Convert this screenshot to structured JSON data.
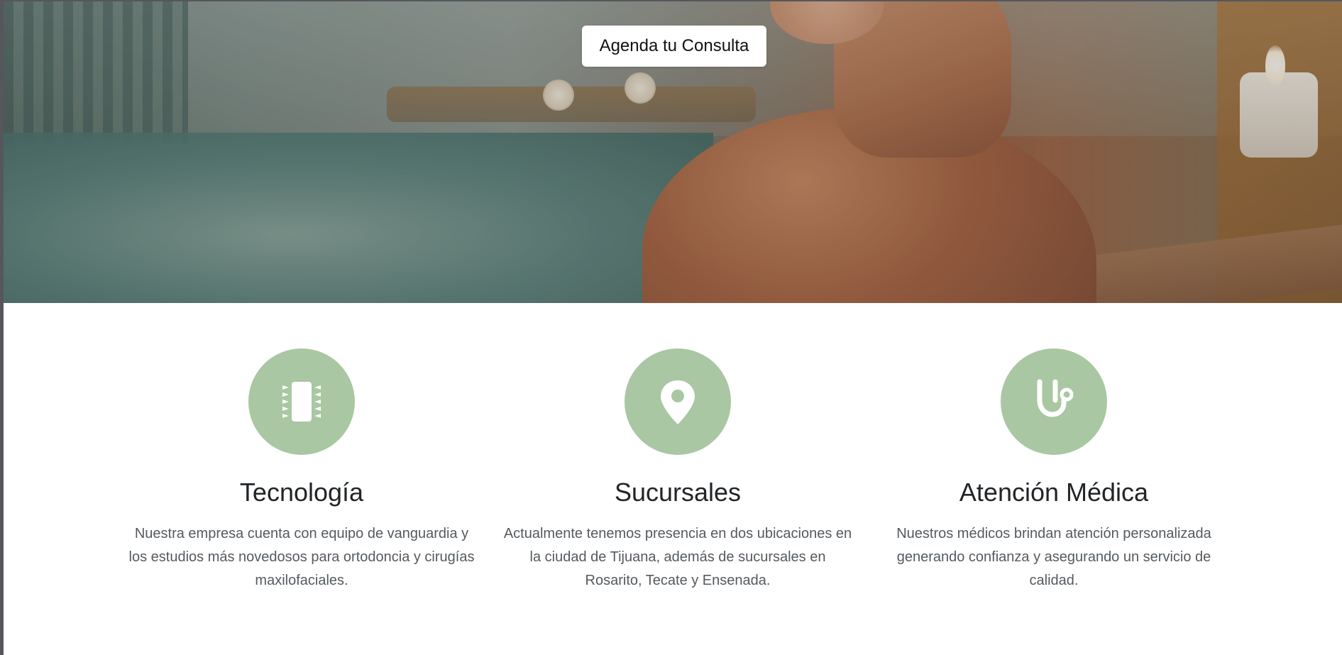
{
  "hero": {
    "cta_label": "Agenda tu Consulta"
  },
  "features": [
    {
      "icon": "microchip-icon",
      "title": "Tecnología",
      "description": "Nuestra empresa cuenta con equipo de vanguardia y los estudios más novedosos para ortodoncia y cirugías maxilofaciales."
    },
    {
      "icon": "map-pin-icon",
      "title": "Sucursales",
      "description": "Actualmente tenemos presencia en dos ubicaciones en la ciudad de Tijuana, además de sucursales en Rosarito, Tecate y Ensenada."
    },
    {
      "icon": "stethoscope-icon",
      "title": "Atención Médica",
      "description": "Nuestros médicos brindan atención personalizada generando confianza y asegurando un servicio de calidad."
    }
  ],
  "colors": {
    "icon_circle": "#a9c7a2",
    "title": "#222528",
    "text": "#555a5f",
    "cta_background": "#ffffff"
  }
}
